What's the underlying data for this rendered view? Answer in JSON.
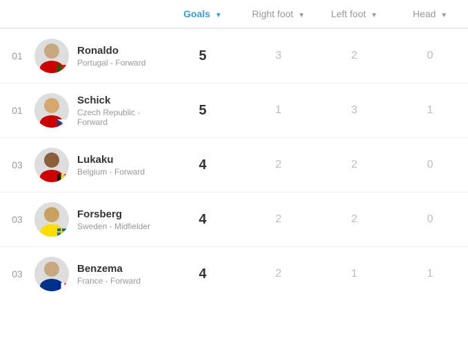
{
  "header": {
    "goals_label": "Goals",
    "right_foot_label": "Right foot",
    "left_foot_label": "Left foot",
    "head_label": "Head"
  },
  "players": [
    {
      "rank": "01",
      "name": "Ronaldo",
      "meta": "Portugal - Forward",
      "goals": "5",
      "right_foot": "3",
      "left_foot": "2",
      "head": "0",
      "nationality": "pt",
      "avatar_head_color": "#c8a882",
      "avatar_body_color": "#cc0000"
    },
    {
      "rank": "01",
      "name": "Schick",
      "meta": "Czech Republic - Forward",
      "goals": "5",
      "right_foot": "1",
      "left_foot": "3",
      "head": "1",
      "nationality": "cz",
      "avatar_head_color": "#d4a870",
      "avatar_body_color": "#cc0000"
    },
    {
      "rank": "03",
      "name": "Lukaku",
      "meta": "Belgium - Forward",
      "goals": "4",
      "right_foot": "2",
      "left_foot": "2",
      "head": "0",
      "nationality": "be",
      "avatar_head_color": "#8b5e3c",
      "avatar_body_color": "#cc0000"
    },
    {
      "rank": "03",
      "name": "Forsberg",
      "meta": "Sweden - Midfielder",
      "goals": "4",
      "right_foot": "2",
      "left_foot": "2",
      "head": "0",
      "nationality": "se",
      "avatar_head_color": "#c8a060",
      "avatar_body_color": "#ffdd00"
    },
    {
      "rank": "03",
      "name": "Benzema",
      "meta": "France - Forward",
      "goals": "4",
      "right_foot": "2",
      "left_foot": "1",
      "head": "1",
      "nationality": "fr",
      "avatar_head_color": "#c8a882",
      "avatar_body_color": "#003189"
    }
  ]
}
